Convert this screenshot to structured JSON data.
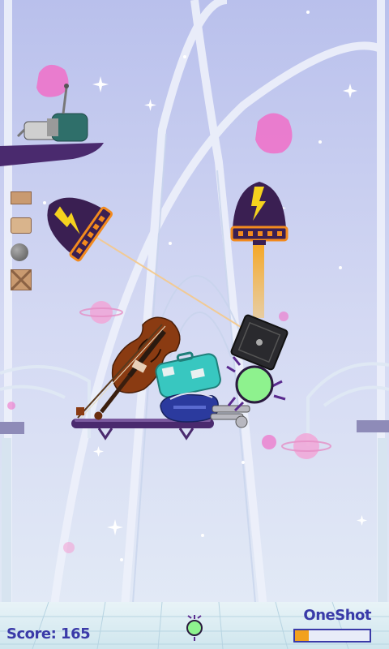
{
  "hud": {
    "score_label": "Score: 165",
    "mode_label": "OneShot",
    "power_fraction": 0.18
  },
  "inventory": [
    {
      "icon": "small-crate-icon"
    },
    {
      "icon": "suitcase-icon"
    },
    {
      "icon": "cannonball-icon"
    },
    {
      "icon": "wooden-crate-icon"
    }
  ],
  "colors": {
    "sky": "#cfd6f2",
    "platform": "#4a2a6e",
    "rocket_body": "#3a1f52",
    "rocket_trim": "#f28a1e",
    "bolt": "#f5d21e",
    "flame": "#f5a623",
    "pink_planet": "#f06fc8",
    "target_ball": "#8ef28e",
    "score_text": "#3a3aa8"
  }
}
